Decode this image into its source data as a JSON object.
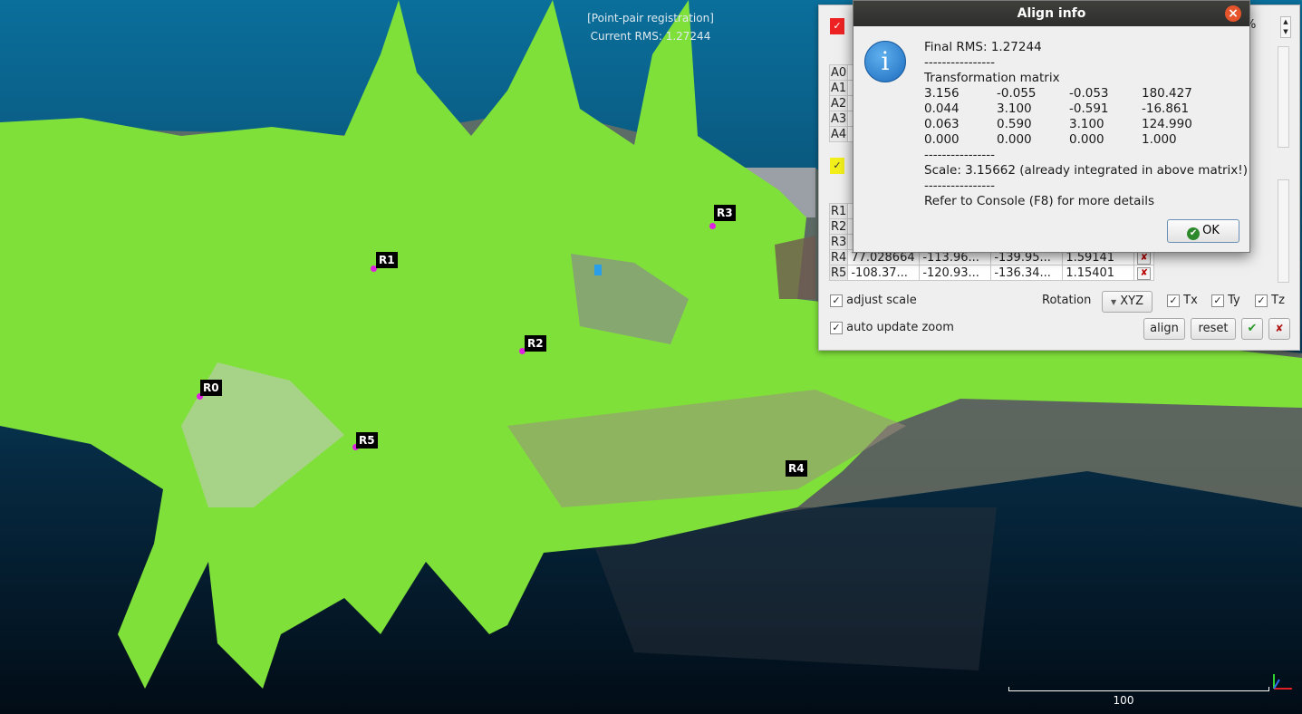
{
  "view": {
    "overlay_title": "[Point-pair registration]",
    "overlay_rms": "Current RMS: 1.27244",
    "markers": [
      "R0",
      "R1",
      "R2",
      "R3",
      "R4",
      "R5"
    ],
    "scale_label": "100"
  },
  "panel": {
    "top_percent": "%",
    "aligned_rows": [
      "A0",
      "A1",
      "A2",
      "A3",
      "A4"
    ],
    "ref_rows": [
      {
        "id": "R1",
        "x": "",
        "y": "",
        "z": "",
        "e": ""
      },
      {
        "id": "R2",
        "x": "",
        "y": "",
        "z": "",
        "e": ""
      },
      {
        "id": "R3",
        "x": "",
        "y": "",
        "z": "",
        "e": ""
      },
      {
        "id": "R4",
        "x": "77.028664",
        "y": "-113.96...",
        "z": "-139.95...",
        "e": "1.59141"
      },
      {
        "id": "R5",
        "x": "-108.37...",
        "y": "-120.93...",
        "z": "-136.34...",
        "e": "1.15401"
      }
    ],
    "adjust_scale_label": "adjust scale",
    "auto_update_zoom_label": "auto update zoom",
    "rotation_label": "Rotation",
    "rotation_value": "XYZ",
    "tx_label": "Tx",
    "ty_label": "Ty",
    "tz_label": "Tz",
    "align_label": "align",
    "reset_label": "reset"
  },
  "dialog": {
    "title": "Align info",
    "final_rms": "Final RMS: 1.27244",
    "separator": "----------------",
    "matrix_title": "Transformation matrix",
    "matrix": [
      [
        "3.156",
        "-0.055",
        "-0.053",
        "180.427"
      ],
      [
        "0.044",
        "3.100",
        "-0.591",
        "-16.861"
      ],
      [
        "0.063",
        "0.590",
        "3.100",
        "124.990"
      ],
      [
        "0.000",
        "0.000",
        "0.000",
        "1.000"
      ]
    ],
    "scale_text": "Scale: 3.15662 (already integrated in above matrix!)",
    "console_text": "Refer to Console (F8) for more details",
    "ok_label": "OK"
  },
  "colors": {
    "cloud": "#7fe03a",
    "marker_dot": "#e020e0",
    "dialog_title_bg": "#3b3b39",
    "close": "#e6542b"
  }
}
